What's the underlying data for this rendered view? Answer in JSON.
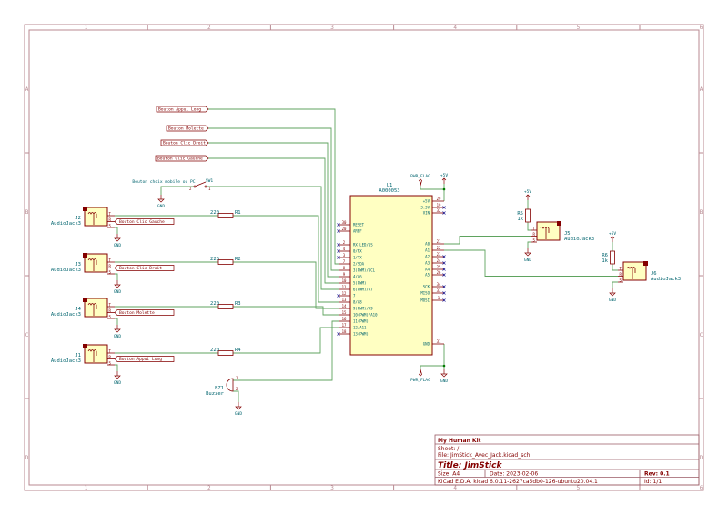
{
  "frame": {
    "columns": [
      "1",
      "2",
      "3",
      "4",
      "5",
      "6"
    ],
    "rows": [
      "A",
      "B",
      "C",
      "D"
    ]
  },
  "title_block": {
    "company": "My Human Kit",
    "sheet": "Sheet: /",
    "file": "File: JimStick_Avec_Jack.kicad_sch",
    "title": "Title: JimStick",
    "size": "Size: A4",
    "date": "Date: 2023-02-06",
    "rev": "Rev: 0.1",
    "tool": "KiCad E.D.A.  kicad 6.0.11-2627ca5db0-126-ubuntu20.04.1",
    "id": "Id: 1/1"
  },
  "u1": {
    "ref": "U1",
    "value": "A000053",
    "left_pins": [
      {
        "name": "RESET",
        "num": "30",
        "nc": true
      },
      {
        "name": "AREF",
        "num": "20",
        "nc": true
      },
      {
        "name": "RX_LED/SS",
        "num": "2",
        "nc": true
      },
      {
        "name": "0/RX",
        "num": "4",
        "nc": true
      },
      {
        "name": "1/TX",
        "num": "3",
        "nc": true
      },
      {
        "name": "2/SDA",
        "num": "7",
        "nc": false
      },
      {
        "name": "3(PWM)/SCL",
        "num": "8",
        "nc": false
      },
      {
        "name": "4/A6",
        "num": "9",
        "nc": false
      },
      {
        "name": "5(PWM)",
        "num": "10",
        "nc": false
      },
      {
        "name": "6(PWM)/A7",
        "num": "11",
        "nc": false
      },
      {
        "name": "7",
        "num": "12",
        "nc": true
      },
      {
        "name": "8/A8",
        "num": "13",
        "nc": false
      },
      {
        "name": "9(PWM)/A9",
        "num": "14",
        "nc": false
      },
      {
        "name": "10(PWM)/A10",
        "num": "15",
        "nc": false
      },
      {
        "name": "11(PWM)",
        "num": "16",
        "nc": false
      },
      {
        "name": "12/A11",
        "num": "17",
        "nc": false
      },
      {
        "name": "13(PWM)",
        "num": "18",
        "nc": true
      }
    ],
    "right_pins": [
      {
        "name": "+5V",
        "num": "29",
        "nc": false
      },
      {
        "name": "3.3V",
        "num": "19",
        "nc": true
      },
      {
        "name": "VIN",
        "num": "32",
        "nc": true
      },
      {
        "name": "A0",
        "num": "21",
        "nc": false
      },
      {
        "name": "A1",
        "num": "22",
        "nc": false
      },
      {
        "name": "A2",
        "num": "23",
        "nc": true
      },
      {
        "name": "A3",
        "num": "24",
        "nc": true
      },
      {
        "name": "A4",
        "num": "25",
        "nc": true
      },
      {
        "name": "A5",
        "num": "26",
        "nc": true
      },
      {
        "name": "SCK",
        "num": "34",
        "nc": true
      },
      {
        "name": "MISO",
        "num": "33",
        "nc": true
      },
      {
        "name": "MOSI",
        "num": "1",
        "nc": true
      },
      {
        "name": "GND",
        "num": "31",
        "nc": false
      }
    ]
  },
  "top_labels": [
    "Bouton Appui Long",
    "Bouton Molette",
    "Bouton Clic Droit",
    "Bouton Clic Gauche"
  ],
  "sw1": {
    "ref": "SW1",
    "desc": "Bouton choix mobile ou PC",
    "pin1": "1",
    "pin2": "2"
  },
  "jacks_left": [
    {
      "ref": "J2",
      "value": "AudioJack3",
      "label": "Bouton Clic Gauche",
      "res_ref": "R1",
      "res_val": "220"
    },
    {
      "ref": "J3",
      "value": "AudioJack3",
      "label": "Bouton Clic Droit",
      "res_ref": "R2",
      "res_val": "220"
    },
    {
      "ref": "J4",
      "value": "AudioJack3",
      "label": "Bouton Molette",
      "res_ref": "R3",
      "res_val": "220"
    },
    {
      "ref": "J1",
      "value": "AudioJack3",
      "label": "Bouton Appui Long",
      "res_ref": "R4",
      "res_val": "220"
    }
  ],
  "jacks_right": [
    {
      "ref": "J5",
      "value": "AudioJack3",
      "res_ref": "R5",
      "res_val": "1k"
    },
    {
      "ref": "J6",
      "value": "AudioJack3",
      "res_ref": "R6",
      "res_val": "1k"
    }
  ],
  "jack_pins": {
    "t": "T",
    "r": "R",
    "s": "S"
  },
  "buzzer": {
    "ref": "BZ1",
    "value": "Buzzer",
    "pin1": "1",
    "pin2": "2"
  },
  "power": {
    "vcc": "+5V",
    "gnd": "GND",
    "flag": "PWR_FLAG"
  },
  "colors": {
    "wire": "#5fa35f",
    "symbol": "#840000",
    "fill": "#ffffc2",
    "ref_text": "#00646e"
  }
}
